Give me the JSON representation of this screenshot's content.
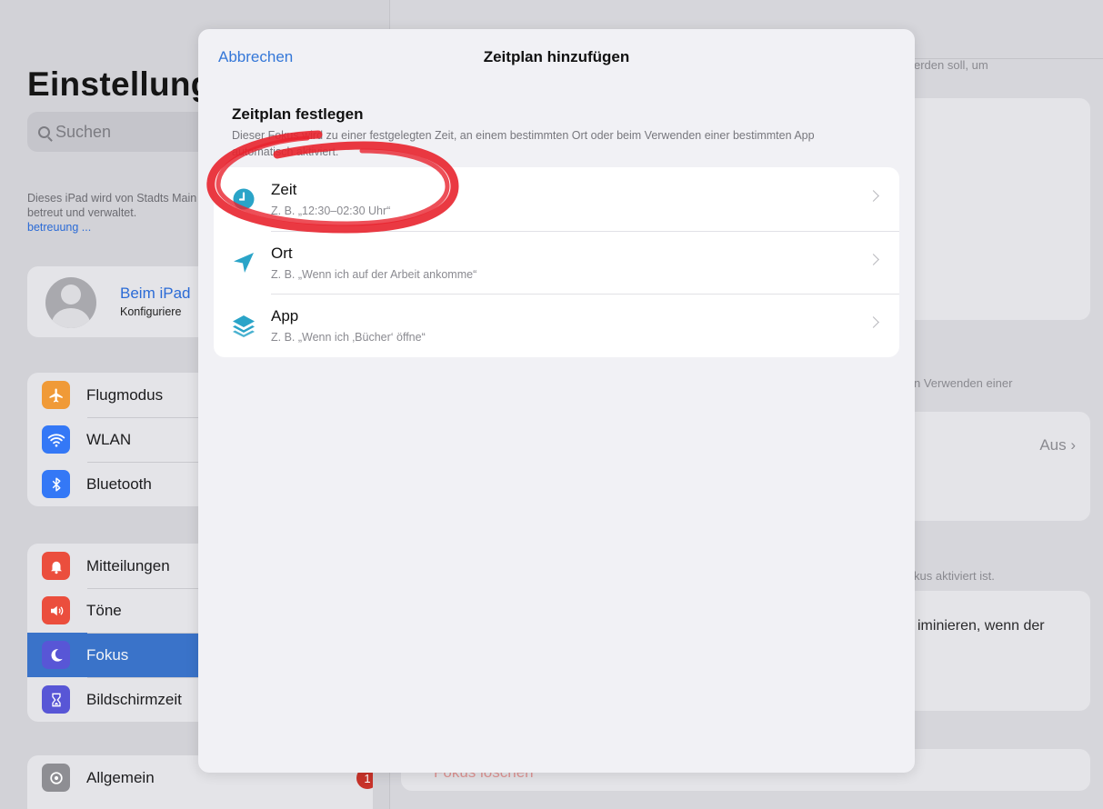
{
  "sidebar": {
    "title": "Einstellungen",
    "search_placeholder": "Suchen",
    "managed_text": "Dieses iPad wird von Stadts Main betreut und verwaltet.",
    "managed_link": "betreuung ...",
    "account": {
      "name": "Beim iPad",
      "subtitle": "Konfiguriere"
    },
    "group_connectivity": [
      {
        "label": "Flugmodus",
        "icon": "airplane-icon",
        "color": "#f09a37"
      },
      {
        "label": "WLAN",
        "icon": "wifi-icon",
        "color": "#3478f6"
      },
      {
        "label": "Bluetooth",
        "icon": "bluetooth-icon",
        "color": "#3478f6"
      }
    ],
    "group_notifications": [
      {
        "label": "Mitteilungen",
        "icon": "bell-icon",
        "color": "#eb4e3d"
      },
      {
        "label": "Töne",
        "icon": "speaker-icon",
        "color": "#eb4e3d"
      },
      {
        "label": "Fokus",
        "icon": "moon-icon",
        "color": "#5856d6",
        "active": true
      },
      {
        "label": "Bildschirmzeit",
        "icon": "hourglass-icon",
        "color": "#5856d6"
      }
    ],
    "group_general": [
      {
        "label": "Allgemein",
        "icon": "gear-icon",
        "color": "#8e8e93",
        "badge": "1"
      }
    ]
  },
  "detail": {
    "text_top": "erden soll, um",
    "text_mid": "n Verwenden einer",
    "schedule_value": "Aus",
    "text_aktiv": "kus aktiviert ist.",
    "text_eliminate": "iminieren, wenn der",
    "delete_label": "Fokus löschen"
  },
  "sheet": {
    "cancel_label": "Abbrechen",
    "title": "Zeitplan hinzufügen",
    "section_title": "Zeitplan festlegen",
    "section_description": "Dieser Fokus wird zu einer festgelegten Zeit, an einem bestimmten Ort oder beim Verwenden einer bestimmten App automatisch aktiviert.",
    "options": [
      {
        "title": "Zeit",
        "subtitle": "Z. B. „12:30–02:30 Uhr“",
        "icon": "clock-icon",
        "color": "#2aa4c8"
      },
      {
        "title": "Ort",
        "subtitle": "Z. B. „Wenn ich auf der Arbeit ankomme“",
        "icon": "location-arrow-icon",
        "color": "#2aa4c8"
      },
      {
        "title": "App",
        "subtitle": "Z. B. „Wenn ich ‚Bücher‘ öffne“",
        "icon": "app-layers-icon",
        "color": "#2aa4c8"
      }
    ]
  },
  "annotation": {
    "color": "#e8232e",
    "shape": "hand-drawn-circle"
  }
}
